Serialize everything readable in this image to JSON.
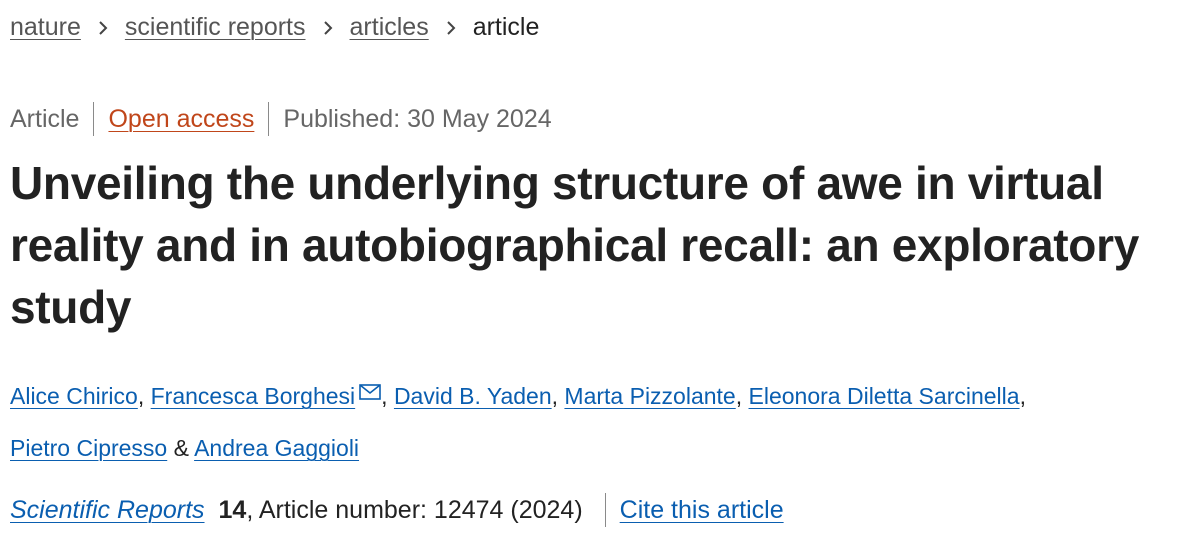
{
  "breadcrumb": {
    "items": [
      {
        "label": "nature"
      },
      {
        "label": "scientific reports"
      },
      {
        "label": "articles"
      }
    ],
    "current": "article"
  },
  "meta": {
    "type": "Article",
    "access": "Open access",
    "published": "Published: 30 May 2024"
  },
  "article": {
    "title": "Unveiling the underlying structure of awe in virtual reality and in autobiographical recall: an exploratory study"
  },
  "authors": {
    "list": [
      "Alice Chirico",
      "Francesca Borghesi",
      "David B. Yaden",
      "Marta Pizzolante",
      "Eleonora Diletta Sarcinella",
      "Pietro Cipresso",
      "Andrea Gaggioli"
    ],
    "separator": ", ",
    "final_separator": " & ",
    "corresponding_icon": "mail-icon"
  },
  "citation": {
    "journal": "Scientific Reports",
    "volume": "14",
    "article_number": ", Article number: 12474 (2024)",
    "cite_label": "Cite this article"
  },
  "colors": {
    "link": "#0a5eb0",
    "open_access": "#c0461a",
    "text": "#222222",
    "muted": "#666666"
  }
}
